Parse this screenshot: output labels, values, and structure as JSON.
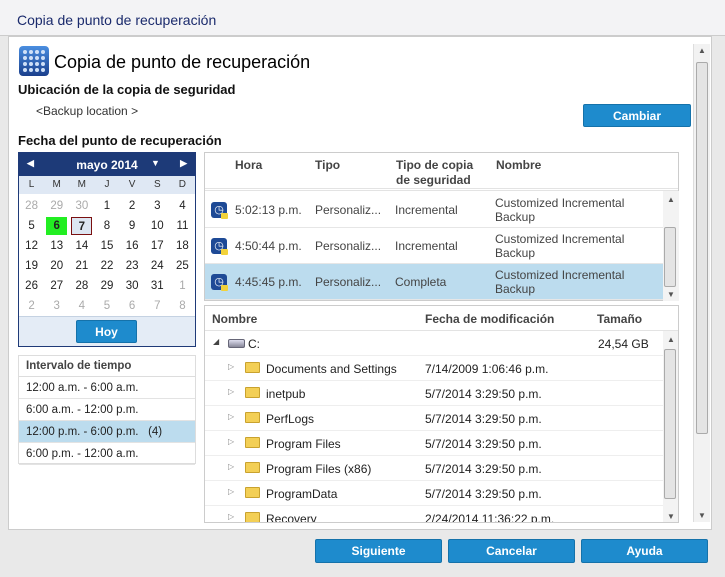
{
  "window": {
    "title": "Copia de punto de recuperación"
  },
  "header": {
    "title": "Copia de punto de recuperación"
  },
  "backup_location": {
    "label": "Ubicación de la copia de seguridad",
    "value": "<Backup location >",
    "change_button": "Cambiar"
  },
  "recovery_date": {
    "label": "Fecha del punto de recuperación"
  },
  "calendar": {
    "month": "mayo 2014",
    "weekdays": [
      "L",
      "M",
      "M",
      "J",
      "V",
      "S",
      "D"
    ],
    "days": [
      {
        "d": "28",
        "o": true
      },
      {
        "d": "29",
        "o": true
      },
      {
        "d": "30",
        "o": true
      },
      {
        "d": "1"
      },
      {
        "d": "2"
      },
      {
        "d": "3"
      },
      {
        "d": "4"
      },
      {
        "d": "5"
      },
      {
        "d": "6",
        "today": true
      },
      {
        "d": "7",
        "sel": true
      },
      {
        "d": "8"
      },
      {
        "d": "9"
      },
      {
        "d": "10"
      },
      {
        "d": "11"
      },
      {
        "d": "12"
      },
      {
        "d": "13"
      },
      {
        "d": "14"
      },
      {
        "d": "15"
      },
      {
        "d": "16"
      },
      {
        "d": "17"
      },
      {
        "d": "18"
      },
      {
        "d": "19"
      },
      {
        "d": "20"
      },
      {
        "d": "21"
      },
      {
        "d": "22"
      },
      {
        "d": "23"
      },
      {
        "d": "24"
      },
      {
        "d": "25"
      },
      {
        "d": "26"
      },
      {
        "d": "27"
      },
      {
        "d": "28"
      },
      {
        "d": "29"
      },
      {
        "d": "30"
      },
      {
        "d": "31"
      },
      {
        "d": "1",
        "o": true
      },
      {
        "d": "2",
        "o": true
      },
      {
        "d": "3",
        "o": true
      },
      {
        "d": "4",
        "o": true
      },
      {
        "d": "5",
        "o": true
      },
      {
        "d": "6",
        "o": true
      },
      {
        "d": "7",
        "o": true
      },
      {
        "d": "8",
        "o": true
      }
    ],
    "today_button": "Hoy"
  },
  "interval": {
    "title": "Intervalo de tiempo",
    "items": [
      "12:00 a.m. - 6:00 a.m.",
      "6:00 a.m. - 12:00 p.m.",
      "12:00 p.m. - 6:00 p.m.   (4)",
      "6:00 p.m. - 12:00 a.m."
    ],
    "selected": 2
  },
  "recovery_points": {
    "columns": [
      "Hora",
      "Tipo",
      "Tipo de copia de seguridad",
      "Nombre"
    ],
    "rows": [
      {
        "time": "5:02:13 p.m.",
        "type": "Personaliz...",
        "backup_type": "Incremental",
        "name": "Customized Incremental Backup"
      },
      {
        "time": "4:50:44 p.m.",
        "type": "Personaliz...",
        "backup_type": "Incremental",
        "name": "Customized Incremental Backup"
      },
      {
        "time": "4:45:45 p.m.",
        "type": "Personaliz...",
        "backup_type": "Completa",
        "name": "Customized Incremental Backup"
      }
    ],
    "selected": 2
  },
  "files": {
    "columns": [
      "Nombre",
      "Fecha de modificación",
      "Tamaño"
    ],
    "drive": {
      "name": "C:",
      "size": "24,54 GB"
    },
    "rows": [
      {
        "name": "Documents and Settings",
        "date": "7/14/2009 1:06:46 p.m."
      },
      {
        "name": "inetpub",
        "date": "5/7/2014 3:29:50 p.m."
      },
      {
        "name": "PerfLogs",
        "date": "5/7/2014 3:29:50 p.m."
      },
      {
        "name": "Program Files",
        "date": "5/7/2014 3:29:50 p.m."
      },
      {
        "name": "Program Files (x86)",
        "date": "5/7/2014 3:29:50 p.m."
      },
      {
        "name": "ProgramData",
        "date": "5/7/2014 3:29:50 p.m."
      },
      {
        "name": "Recovery",
        "date": "2/24/2014 11:36:22 p.m."
      }
    ]
  },
  "footer": {
    "next": "Siguiente",
    "cancel": "Cancelar",
    "help": "Ayuda"
  },
  "colors": {
    "accent": "#1e8bcd",
    "calendar_header": "#1d3a78",
    "selection": "#bcdcee",
    "today": "#22ee22"
  }
}
